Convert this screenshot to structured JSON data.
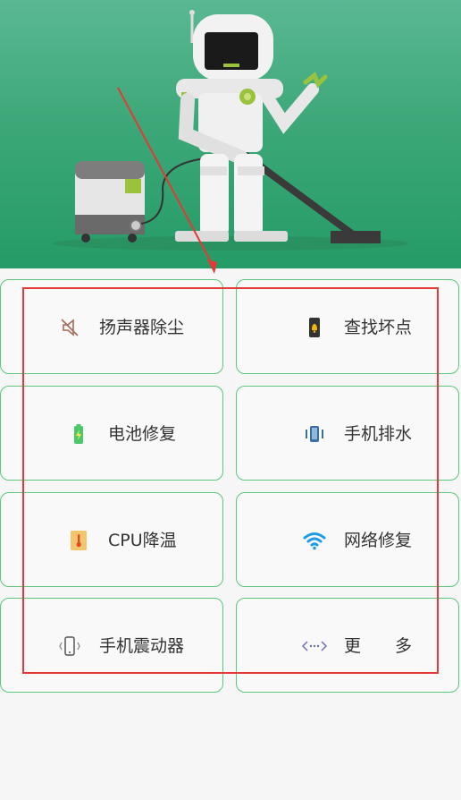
{
  "tools": [
    {
      "label": "扬声器除尘",
      "icon": "speaker-muted-icon"
    },
    {
      "label": "查找坏点",
      "icon": "phone-bell-icon"
    },
    {
      "label": "电池修复",
      "icon": "battery-charging-icon"
    },
    {
      "label": "手机排水",
      "icon": "phone-vibrate-icon"
    },
    {
      "label": "CPU降温",
      "icon": "thermometer-icon"
    },
    {
      "label": "网络修复",
      "icon": "wifi-icon"
    },
    {
      "label": "手机震动器",
      "icon": "phone-shake-icon"
    },
    {
      "label": "更　　多",
      "icon": "more-icon"
    }
  ],
  "colors": {
    "card_border": "#5cc77d",
    "banner_green": "#3da879",
    "annotation_red": "#e53935",
    "wifi_blue": "#1e9be8"
  }
}
